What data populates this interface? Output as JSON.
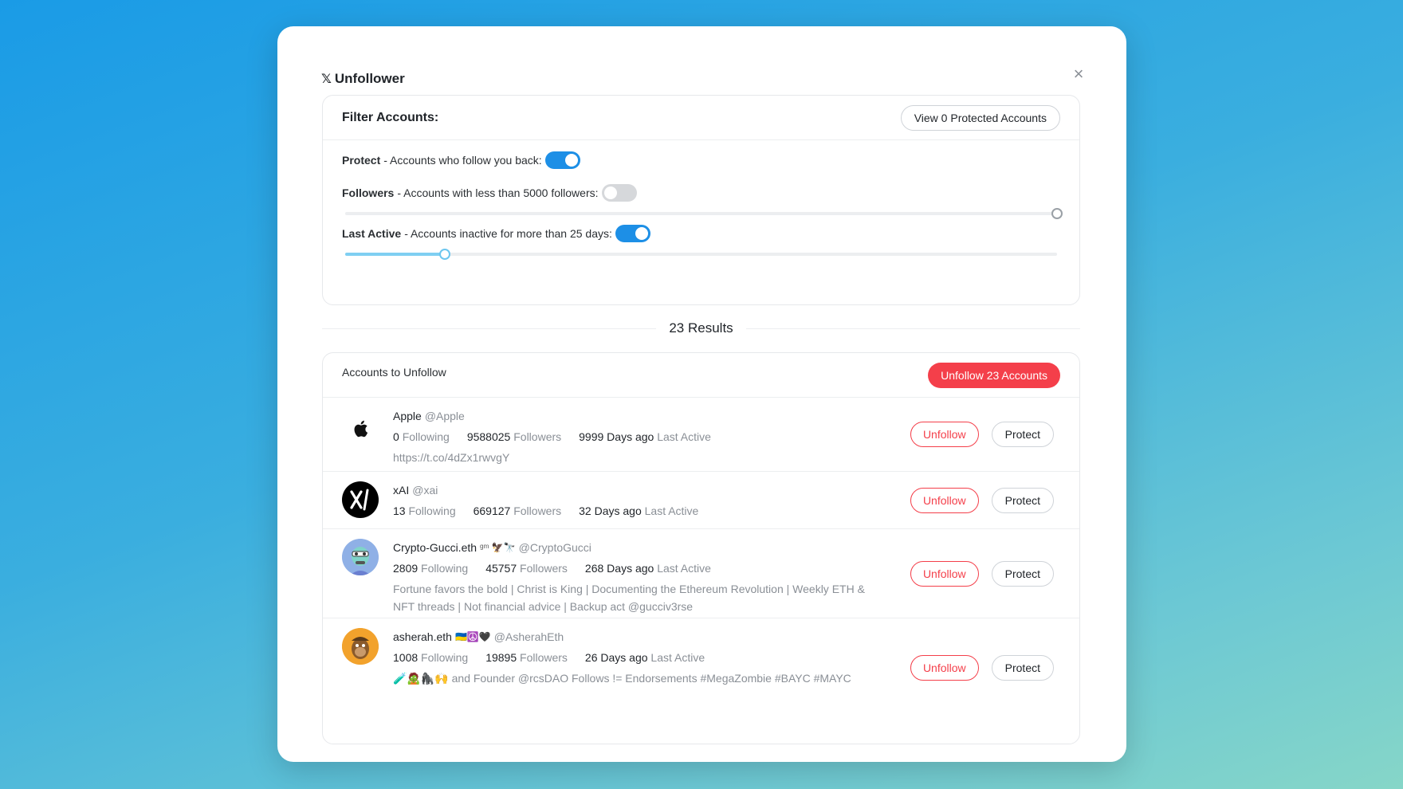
{
  "app": {
    "title": "Unfollower",
    "logo": "𝕏",
    "close": "×"
  },
  "filter": {
    "heading": "Filter Accounts:",
    "view_protected_label": "View 0 Protected Accounts",
    "protect": {
      "label": "Protect",
      "desc": "- Accounts who follow you back:",
      "enabled": true
    },
    "followers": {
      "label": "Followers",
      "desc": "- Accounts with less than 5000 followers:",
      "enabled": false,
      "slider_fraction": 1.0
    },
    "last_active": {
      "label": "Last Active",
      "desc": "- Accounts inactive for more than 25 days:",
      "enabled": true,
      "slider_fraction": 0.14
    }
  },
  "results": {
    "label": "23 Results"
  },
  "list": {
    "heading": "Accounts to Unfollow",
    "unfollow_all_label": "Unfollow 23 Accounts",
    "unfollow_label": "Unfollow",
    "protect_label": "Protect",
    "following_label": "Following",
    "followers_label": "Followers",
    "last_active_label": "Last Active",
    "accounts": [
      {
        "name": "Apple",
        "handle": "@Apple",
        "emoji": "",
        "following": "0",
        "followers": "9588025",
        "last_active": "9999 Days ago",
        "bio": "https://t.co/4dZx1rwvgY",
        "avatar_icon": "apple-logo"
      },
      {
        "name": "xAI",
        "handle": "@xai",
        "emoji": "",
        "following": "13",
        "followers": "669127",
        "last_active": "32 Days ago",
        "bio": "",
        "avatar_icon": "xai-logo"
      },
      {
        "name": "Crypto-Gucci.eth",
        "handle": "@CryptoGucci",
        "emoji": "ᵍᵐ 🦅🔭",
        "following": "2809",
        "followers": "45757",
        "last_active": "268 Days ago",
        "bio": "Fortune favors the bold | Christ is King | Documenting the Ethereum Revolution | Weekly ETH & NFT threads | Not financial advice | Backup act @gucciv3rse",
        "avatar_icon": "nft-avatar"
      },
      {
        "name": "asherah.eth",
        "handle": "@AsherahEth",
        "emoji": "🇺🇦☮️🖤",
        "following": "1008",
        "followers": "19895",
        "last_active": "26 Days ago",
        "bio": "🧪🧟🦍🙌 and Founder @rcsDAO Follows != Endorsements #MegaZombie #BAYC #MAYC",
        "avatar_icon": "ape-avatar"
      }
    ]
  },
  "colors": {
    "accent_blue": "#1d8fe6",
    "danger_red": "#f43f4a"
  }
}
